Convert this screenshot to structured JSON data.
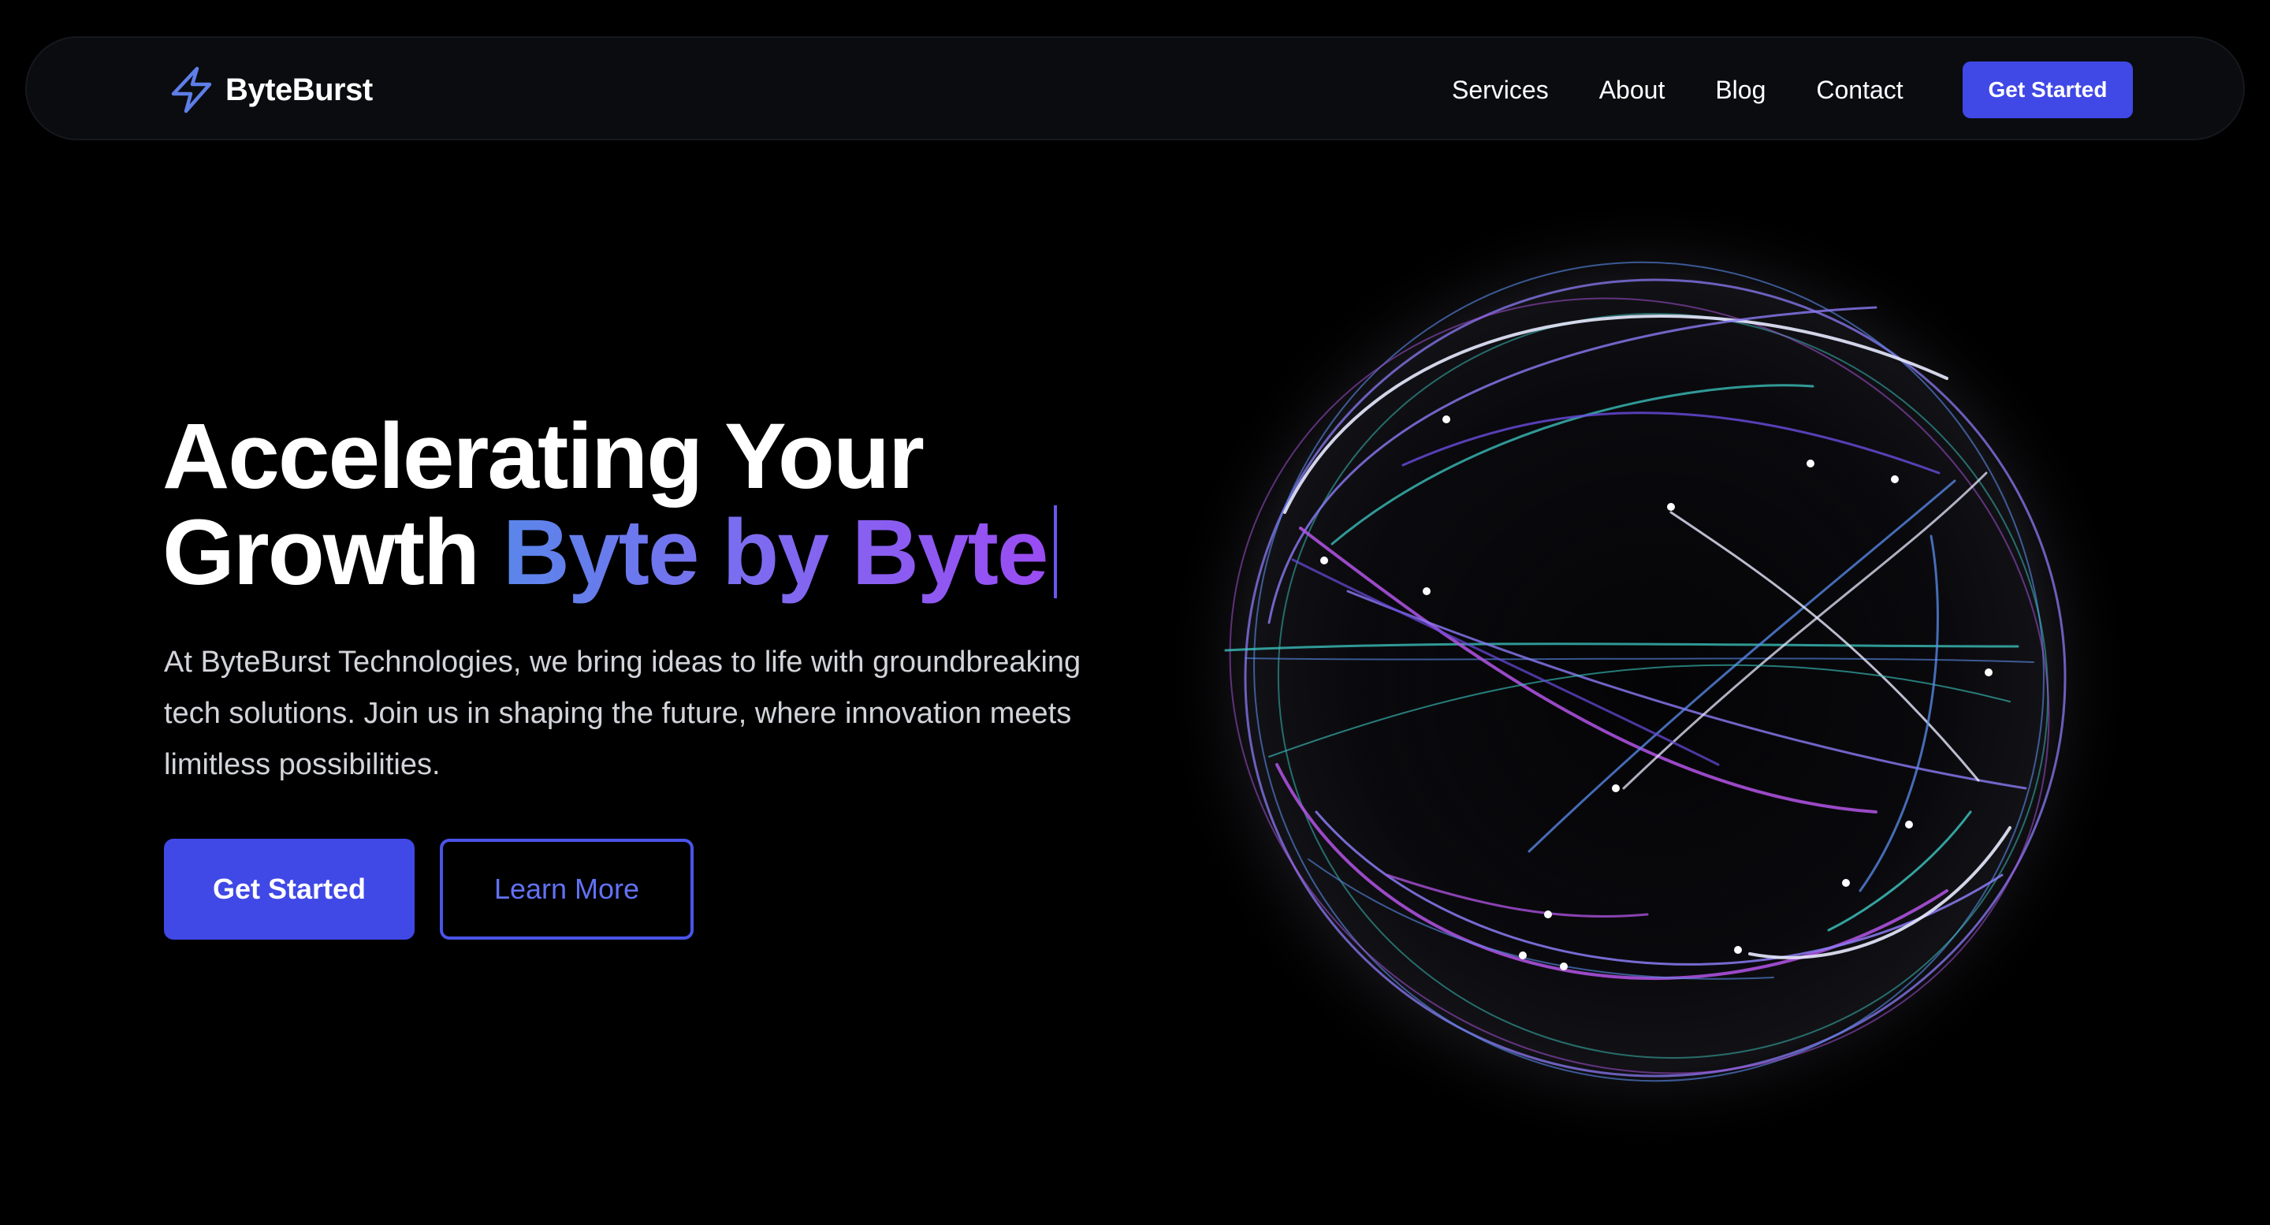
{
  "brand": {
    "name": "ByteBurst",
    "accent": "#4048e6"
  },
  "nav": {
    "links": [
      "Services",
      "About",
      "Blog",
      "Contact"
    ],
    "cta_label": "Get Started"
  },
  "hero": {
    "title_line1": "Accelerating Your",
    "title_line2_prefix": "Growth ",
    "title_highlight": "Byte by Byte",
    "description": "At ByteBurst Technologies, we bring ideas to life with groundbreaking tech solutions. Join us in shaping the future, where innovation meets limitless possibilities.",
    "primary_button": "Get Started",
    "secondary_button": "Learn More"
  },
  "icons": {
    "logo": "lightning-bolt-icon"
  },
  "colors": {
    "background": "#000000",
    "gradient_start": "#5a86ea",
    "gradient_end": "#9a4cf2",
    "orbit_colors": [
      "#8b7bf5",
      "#b455e8",
      "#5b8def",
      "#3ec9c4",
      "#e8eaff",
      "#6c4ce0"
    ]
  }
}
